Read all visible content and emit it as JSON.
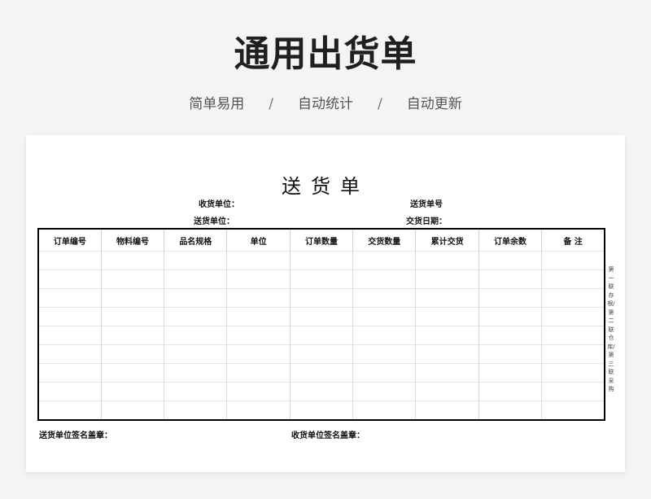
{
  "banner": {
    "title": "通用出货单",
    "tags": [
      "简单易用",
      "自动统计",
      "自动更新"
    ],
    "separator": "/"
  },
  "form": {
    "title": "送货单",
    "receiver_label": "收货单位：",
    "sender_label": "送货单位：",
    "order_no_label": "送货单号",
    "date_label": "交货日期：",
    "columns": [
      "订单编号",
      "物料编号",
      "品名规格",
      "单位",
      "订单数量",
      "交货数量",
      "累计交货",
      "订单余数",
      "备  注"
    ],
    "side_note": "第一联存根/第二联仓库/第三联采购",
    "sender_sign": "送货单位签名盖章：",
    "receiver_sign": "收货单位签名盖章："
  }
}
